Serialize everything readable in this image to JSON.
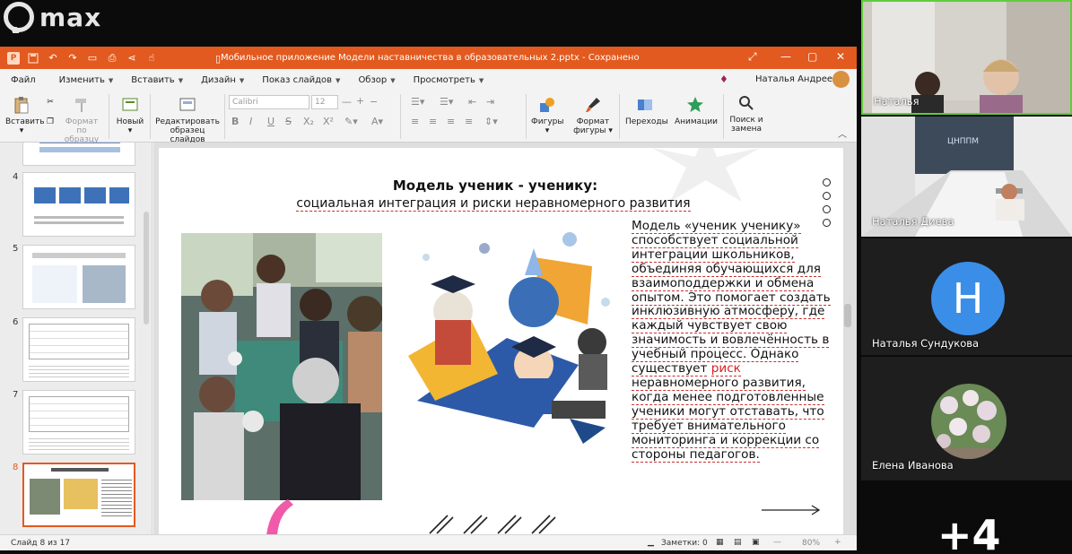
{
  "messenger": {
    "logo_text": "max"
  },
  "window": {
    "title": "Мобильное приложение  Модели наставничества в образовательных 2.pptx - Сохранено"
  },
  "menu": {
    "items": [
      "Файл",
      "Изменить",
      "Вставить",
      "Дизайн",
      "Показ слайдов",
      "Обзор",
      "Просмотреть"
    ],
    "user_name": "Наталья Андреевна"
  },
  "ribbon": {
    "paste": "Вставить",
    "format_painter_1": "Формат по",
    "format_painter_2": "образцу",
    "new_1": "Новый",
    "edit_master_1": "Редактировать",
    "edit_master_2": "образец слайдов",
    "font_name": "Calibri",
    "font_size": "12",
    "shapes": "Фигуры",
    "shape_format_1": "Формат",
    "shape_format_2": "фигуры",
    "transitions": "Переходы",
    "animations": "Анимации",
    "find_1": "Поиск и",
    "find_2": "замена"
  },
  "thumbnails": {
    "numbers": [
      "4",
      "5",
      "6",
      "7",
      "8"
    ],
    "active": "8"
  },
  "slide": {
    "title_line1": "Модель ученик - ученику:",
    "title_line2": "социальная интеграция и риски неравномерного развития",
    "body_before_red": "Модель «ученик ученику» способствует социальной интеграции школьников, объединяя обучающихся для взаимоподдержки и обмена опытом. Это помогает создать инклюзивную атмосферу, где каждый чувствует свою значимость и вовлечённость в учебный процесс. Однако существует",
    "body_red": "риск",
    "body_after_red": "неравномерного развития, когда менее подготовленные ученики могут отставать, что требует внимательного мониторинга и коррекции со стороны педагогов."
  },
  "status": {
    "slide_counter": "Слайд 8 из 17",
    "notes": "Заметки: 0",
    "zoom": "80%"
  },
  "participants": [
    {
      "name": "Наталья"
    },
    {
      "name": "Наталья Диева"
    },
    {
      "name": "Наталья Сундукова",
      "initial": "Н"
    },
    {
      "name": "Елена Иванова"
    }
  ],
  "more_participants": "+4",
  "colors": {
    "accent": "#e25a1f",
    "avatar_blue": "#3b8ee8",
    "active_speaker": "#5fce3a"
  }
}
